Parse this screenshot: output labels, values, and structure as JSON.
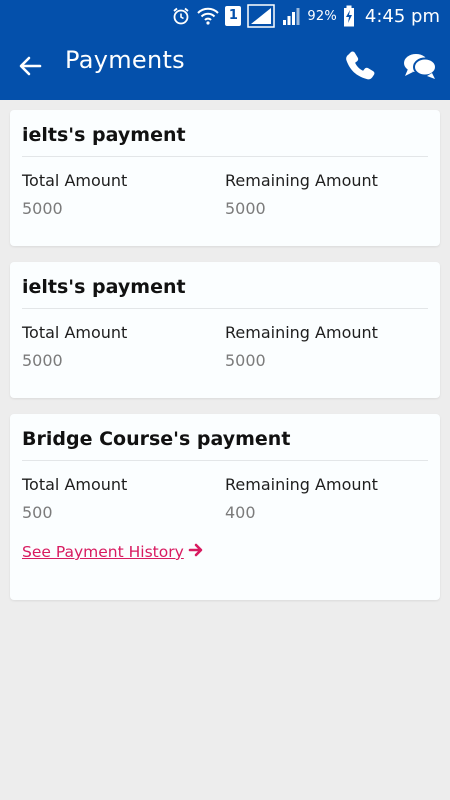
{
  "status_bar": {
    "battery_percent": "92%",
    "time": "4:45 pm",
    "sim_slot": "1"
  },
  "toolbar": {
    "title": "Payments",
    "icons": [
      "back-arrow-icon",
      "phone-icon",
      "chat-icon"
    ]
  },
  "payments": [
    {
      "title": "ielts's payment",
      "total_label": "Total Amount",
      "total_value": "5000",
      "remaining_label": "Remaining Amount",
      "remaining_value": "5000"
    },
    {
      "title": "ielts's payment",
      "total_label": "Total Amount",
      "total_value": "5000",
      "remaining_label": "Remaining Amount",
      "remaining_value": "5000"
    },
    {
      "title": "Bridge Course's payment",
      "total_label": "Total Amount",
      "total_value": "500",
      "remaining_label": "Remaining Amount",
      "remaining_value": "400",
      "history_link": "See Payment History"
    }
  ],
  "colors": {
    "header": "#0450ab",
    "link": "#d81b60",
    "background": "#ededed",
    "card": "#fbfeff"
  }
}
